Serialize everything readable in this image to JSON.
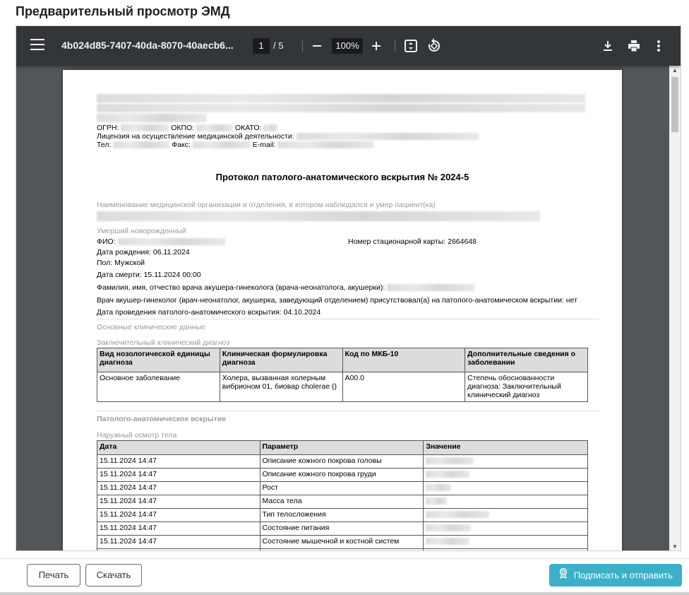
{
  "dialog": {
    "title": "Предварительный просмотр ЭМД"
  },
  "toolbar": {
    "filename": "4b024d85-7407-40da-8070-40aecb6...",
    "current_page": "1",
    "total_pages": "/  5",
    "zoom": "100%",
    "icons": [
      "menu-icon",
      "zoom-out-icon",
      "zoom-in-icon",
      "fit-page-icon",
      "rotate-icon",
      "download-icon",
      "print-icon",
      "more-icon"
    ]
  },
  "document": {
    "ogrn_label": "ОГРН:",
    "okpo_label": "ОКПО:",
    "okato_label": "ОКАТО:",
    "license_label": "Лицензия на осуществление медицинской деятельности:",
    "tel_label": "Тел:",
    "fax_label": "Факс:",
    "email_label": "E-mail:",
    "title": "Протокол патолого-анатомического вскрытия № 2024-5",
    "org_section_label": "Наименование медицинской организации и отделения, в котором наблюдался и умер пациент(ка)",
    "newborn_section_label": "Умерший новорожденный",
    "fio_label": "ФИО:",
    "card_number": "Номер стационарной карты: 2664648",
    "birth_date": "Дата рождения: 06.11.2024",
    "sex": "Пол: Мужской",
    "death_date": "Дата смерти: 15.11.2024 00:00",
    "doctor_name_label": "Фамилия, имя, отчество врача акушера-гинеколога (врача-неонатолога, акушерки):",
    "doctor_present": "Врач акушер-гинеколог (врач-неонатолог, акушерка, заведующий отделением) присутствовал(а) на патолого-анатомическом вскрытии: нет",
    "autopsy_date": "Дата проведения патолого-анатомического вскрытия: 04.10.2024",
    "clinical_section_label": "Основные клинические данные",
    "final_diag_label": "Заключительный клинический диагноз",
    "diag_table": {
      "headers": [
        "Вид нозологической единицы диагноза",
        "Клиническая формулировка диагноза",
        "Код по МКБ-10",
        "Дополнительные сведения о заболевании"
      ],
      "rows": [
        [
          "Основное заболевание",
          "Холера, вызванная холерным вибрионом 01, биовар cholerae ()",
          "A00.0",
          "Степень обоснованности диагноза: Заключительный клинический диагноз"
        ]
      ]
    },
    "autopsy_section_label": "Патолого-анатомическое вскрытие",
    "external_exam_label": "Наружный осмотр тела",
    "exam_table": {
      "headers": [
        "Дата",
        "Параметр",
        "Значение"
      ],
      "rows": [
        [
          "15.11.2024 14:47",
          "Описание кожного покрова головы"
        ],
        [
          "15.11.2024 14:47",
          "Описание кожного покрова груди"
        ],
        [
          "15.11.2024 14:47",
          "Рост"
        ],
        [
          "15.11.2024 14:47",
          "Масса тела"
        ],
        [
          "15.11.2024 14:47",
          "Тип телосложения"
        ],
        [
          "15.11.2024 14:47",
          "Состояние питания"
        ],
        [
          "15.11.2024 14:47",
          "Состояние мышечной и костной систем"
        ]
      ]
    }
  },
  "footer": {
    "print_label": "Печать",
    "download_label": "Скачать",
    "sign_label": "Подписать и отправить",
    "sign_icon": "certificate-icon"
  }
}
